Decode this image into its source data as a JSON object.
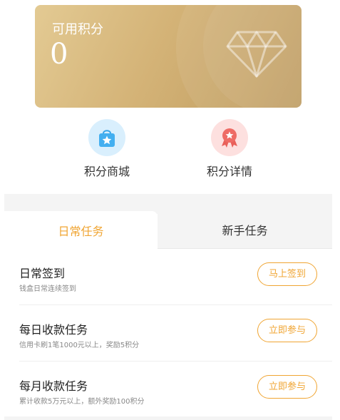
{
  "points_card": {
    "label": "可用积分",
    "value": "0",
    "icon": "diamond-icon"
  },
  "shortcuts": [
    {
      "label": "积分商城",
      "icon": "shopping-bag-star-icon",
      "color": "#d9effd"
    },
    {
      "label": "积分详情",
      "icon": "medal-ribbon-icon",
      "color": "#fde0df"
    }
  ],
  "tabs": [
    {
      "label": "日常任务",
      "active": true
    },
    {
      "label": "新手任务",
      "active": false
    }
  ],
  "tasks": [
    {
      "title": "日常签到",
      "desc": "钱盒日常连续签到",
      "button": "马上签到"
    },
    {
      "title": "每日收款任务",
      "desc": "信用卡刷1笔1000元以上，奖励5积分",
      "button": "立即参与"
    },
    {
      "title": "每月收款任务",
      "desc": "累计收款5万元以上，额外奖励100积分",
      "button": "立即参与"
    }
  ],
  "colors": {
    "accent": "#f0a533",
    "card_gold": "#d4b377"
  }
}
